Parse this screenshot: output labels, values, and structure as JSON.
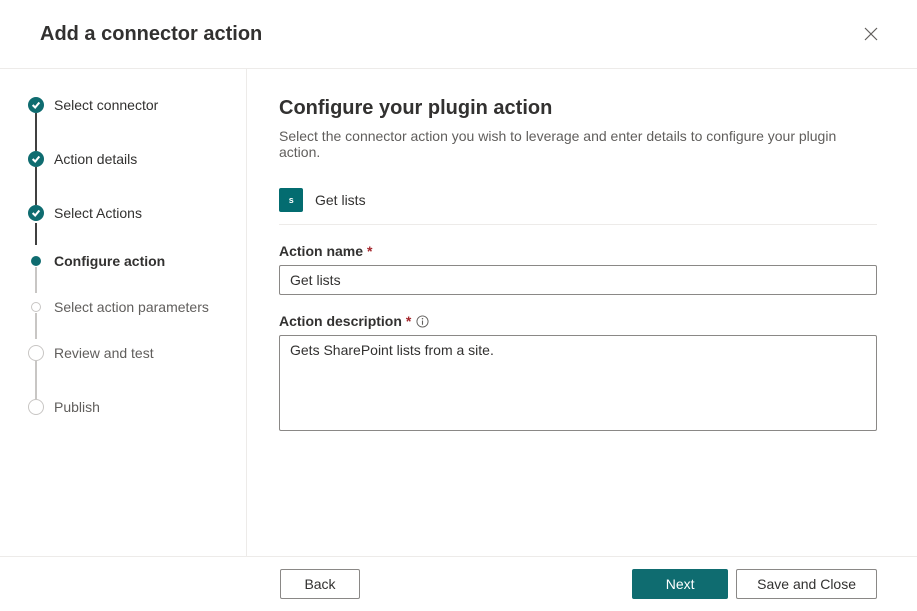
{
  "header": {
    "title": "Add a connector action"
  },
  "sidebar": {
    "steps": [
      {
        "label": "Select connector",
        "state": "completed"
      },
      {
        "label": "Action details",
        "state": "completed"
      },
      {
        "label": "Select Actions",
        "state": "completed"
      },
      {
        "label": "Configure action",
        "state": "current"
      },
      {
        "label": "Select action parameters",
        "state": "upcoming-small"
      },
      {
        "label": "Review and test",
        "state": "upcoming"
      },
      {
        "label": "Publish",
        "state": "upcoming"
      }
    ]
  },
  "main": {
    "heading": "Configure your plugin action",
    "subtitle": "Select the connector action you wish to leverage and enter details to configure your plugin action.",
    "action": {
      "icon_label": "s",
      "name": "Get lists"
    },
    "fields": {
      "action_name": {
        "label": "Action name",
        "value": "Get lists"
      },
      "action_description": {
        "label": "Action description",
        "value": "Gets SharePoint lists from a site."
      }
    }
  },
  "footer": {
    "back": "Back",
    "next": "Next",
    "save_close": "Save and Close"
  }
}
